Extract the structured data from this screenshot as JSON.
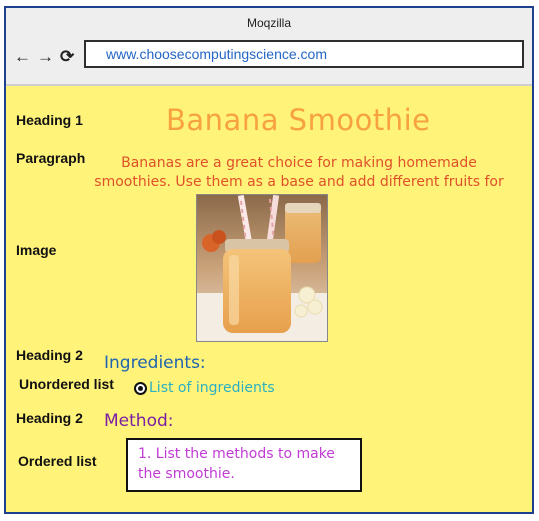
{
  "window": {
    "title": "Moqzilla"
  },
  "nav": {
    "back": "←",
    "forward": "→",
    "reload": "⟳"
  },
  "address_bar": {
    "url": "www.choosecomputingscience.com"
  },
  "labels": {
    "heading1": "Heading 1",
    "paragraph": "Paragraph",
    "image": "Image",
    "heading2a": "Heading 2",
    "unordered": "Unordered list",
    "heading2b": "Heading 2",
    "ordered": "Ordered list"
  },
  "content": {
    "title": "Banana Smoothie",
    "paragraph": "Bananas are a great choice for making homemade smoothies. Use them as a base and add different fruits for a",
    "heading_ingredients": "Ingredients:",
    "list_item": "List of ingredients",
    "heading_method": "Method:",
    "ordered_text": "1. List the methods to make the smoothie."
  },
  "colors": {
    "page_bg": "#fff37a",
    "title": "#f7a23e",
    "paragraph": "#e0512a",
    "ingredients": "#2164b0",
    "method": "#7b1fa2",
    "list": "#2ab0c2",
    "ordered": "#c13bd4",
    "url": "#2466c4"
  }
}
